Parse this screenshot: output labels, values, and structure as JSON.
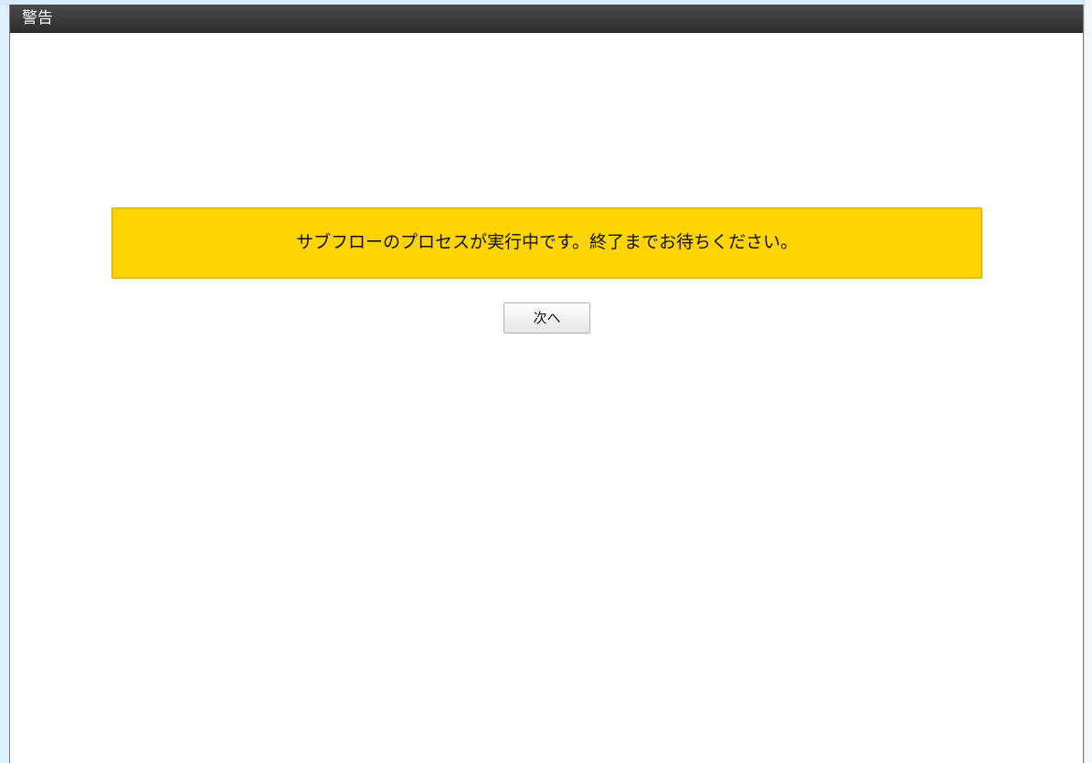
{
  "titlebar": {
    "title": "警告"
  },
  "alert": {
    "message": "サブフローのプロセスが実行中です。終了までお待ちください。"
  },
  "actions": {
    "next_label": "次へ"
  },
  "colors": {
    "titlebar_bg": "#333333",
    "alert_bg": "#ffd400",
    "page_bg": "#ffffff",
    "outer_bg": "#ddf0fb"
  }
}
